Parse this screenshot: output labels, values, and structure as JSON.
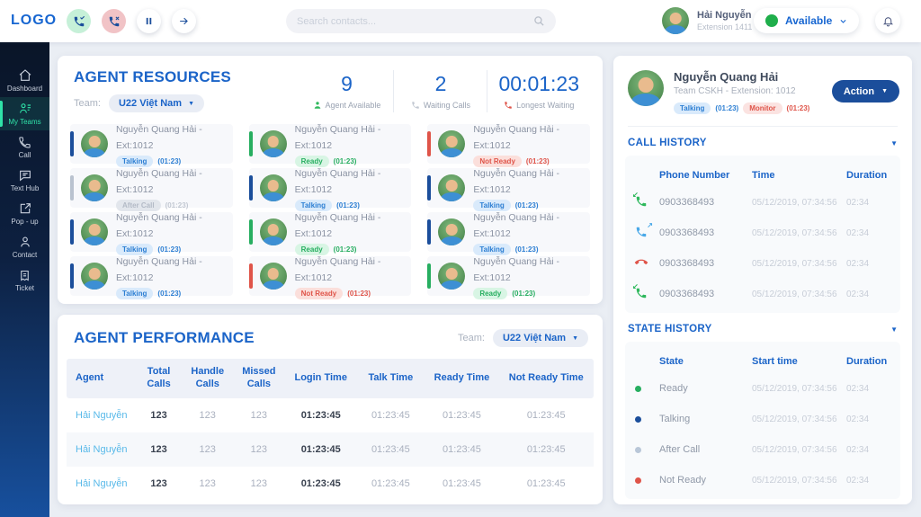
{
  "topbar": {
    "logo": "LOGO",
    "search_placeholder": "Search contacts...",
    "user": {
      "name": "Hải Nguyễn",
      "extension": "Extension 1411"
    },
    "status": {
      "label": "Available"
    },
    "icons": {
      "answer": "phone-check",
      "decline": "phone-x",
      "pause": "pause",
      "forward": "arrow-right",
      "search": "magnifier",
      "bell": "bell"
    }
  },
  "sidebar": {
    "items": [
      {
        "label": "Dashboard"
      },
      {
        "label": "My Teams"
      },
      {
        "label": "Call"
      },
      {
        "label": "Text Hub"
      },
      {
        "label": "Pop - up"
      },
      {
        "label": "Contact"
      },
      {
        "label": "Ticket"
      }
    ]
  },
  "agent_resources": {
    "title": "AGENT RESOURCES",
    "team_label": "Team:",
    "team_value": "U22 Việt Nam",
    "stats": [
      {
        "value": "9",
        "label": "Agent Available"
      },
      {
        "value": "2",
        "label": "Waiting Calls"
      },
      {
        "value": "00:01:23",
        "label": "Longest Waiting"
      }
    ],
    "agents": [
      {
        "name": "Nguyễn Quang Hải - Ext:1012",
        "status": "Talking",
        "time": "(01:23)",
        "status_class": "talking"
      },
      {
        "name": "Nguyễn Quang Hải - Ext:1012",
        "status": "Ready",
        "time": "(01:23)",
        "status_class": "ready"
      },
      {
        "name": "Nguyễn Quang Hải - Ext:1012",
        "status": "Not Ready",
        "time": "(01:23)",
        "status_class": "notready"
      },
      {
        "name": "Nguyễn Quang Hải - Ext:1012",
        "status": "After Call",
        "time": "(01:23)",
        "status_class": "aftercall"
      },
      {
        "name": "Nguyễn Quang Hải - Ext:1012",
        "status": "Talking",
        "time": "(01:23)",
        "status_class": "talking"
      },
      {
        "name": "Nguyễn Quang Hải - Ext:1012",
        "status": "Talking",
        "time": "(01:23)",
        "status_class": "talking"
      },
      {
        "name": "Nguyễn Quang Hải - Ext:1012",
        "status": "Talking",
        "time": "(01:23)",
        "status_class": "talking"
      },
      {
        "name": "Nguyễn Quang Hải - Ext:1012",
        "status": "Ready",
        "time": "(01:23)",
        "status_class": "ready"
      },
      {
        "name": "Nguyễn Quang Hải - Ext:1012",
        "status": "Talking",
        "time": "(01:23)",
        "status_class": "talking"
      },
      {
        "name": "Nguyễn Quang Hải - Ext:1012",
        "status": "Talking",
        "time": "(01:23)",
        "status_class": "talking"
      },
      {
        "name": "Nguyễn Quang Hải - Ext:1012",
        "status": "Not Ready",
        "time": "(01:23)",
        "status_class": "notready"
      },
      {
        "name": "Nguyễn Quang Hải - Ext:1012",
        "status": "Ready",
        "time": "(01:23)",
        "status_class": "ready"
      }
    ]
  },
  "agent_performance": {
    "title": "AGENT PERFORMANCE",
    "team_label": "Team:",
    "team_value": "U22 Việt Nam",
    "columns": [
      "Agent",
      "Total Calls",
      "Handle Calls",
      "Missed Calls",
      "Login Time",
      "Talk Time",
      "Ready Time",
      "Not Ready Time"
    ],
    "rows": [
      {
        "agent": "Hải Nguyễn",
        "total": "123",
        "handle": "123",
        "missed": "123",
        "login": "01:23:45",
        "talk": "01:23:45",
        "ready": "01:23:45",
        "not_ready": "01:23:45"
      },
      {
        "agent": "Hải Nguyễn",
        "total": "123",
        "handle": "123",
        "missed": "123",
        "login": "01:23:45",
        "talk": "01:23:45",
        "ready": "01:23:45",
        "not_ready": "01:23:45"
      },
      {
        "agent": "Hải Nguyễn",
        "total": "123",
        "handle": "123",
        "missed": "123",
        "login": "01:23:45",
        "talk": "01:23:45",
        "ready": "01:23:45",
        "not_ready": "01:23:45"
      }
    ]
  },
  "agent_detail": {
    "name": "Nguyễn Quang Hải",
    "subtitle": "Team CSKH - Extension: 1012",
    "badge_talking": "Talking",
    "badge_talking_time": "(01:23)",
    "badge_monitor": "Monitor",
    "badge_monitor_time": "(01:23)",
    "action_label": "Action",
    "call_history": {
      "title": "CALL HISTORY",
      "columns": [
        "Phone Number",
        "Time",
        "Duration"
      ],
      "rows": [
        {
          "type": "incoming",
          "phone": "0903368493",
          "time": "05/12/2019, 07:34:56",
          "duration": "02:34"
        },
        {
          "type": "outgoing",
          "phone": "0903368493",
          "time": "05/12/2019, 07:34:56",
          "duration": "02:34"
        },
        {
          "type": "missed",
          "phone": "0903368493",
          "time": "05/12/2019, 07:34:56",
          "duration": "02:34"
        },
        {
          "type": "incoming",
          "phone": "0903368493",
          "time": "05/12/2019, 07:34:56",
          "duration": "02:34"
        }
      ]
    },
    "state_history": {
      "title": "STATE HISTORY",
      "columns": [
        "State",
        "Start time",
        "Duration"
      ],
      "rows": [
        {
          "state": "Ready",
          "state_class": "ready",
          "start": "05/12/2019, 07:34:56",
          "duration": "02:34"
        },
        {
          "state": "Talking",
          "state_class": "talking",
          "start": "05/12/2019, 07:34:56",
          "duration": "02:34"
        },
        {
          "state": "After Call",
          "state_class": "aftercall",
          "start": "05/12/2019, 07:34:56",
          "duration": "02:34"
        },
        {
          "state": "Not Ready",
          "state_class": "notready",
          "start": "05/12/2019, 07:34:56",
          "duration": "02:34"
        }
      ]
    }
  },
  "colors": {
    "primary_blue": "#1b64c8",
    "dark_blue": "#1b4e9b",
    "green": "#27ae60",
    "status_green": "#1fae4b",
    "red": "#df5449",
    "link_blue": "#58b9e9",
    "sidebar_active_teal": "#2fe3a8",
    "gray_text": "#9aa3b2"
  }
}
